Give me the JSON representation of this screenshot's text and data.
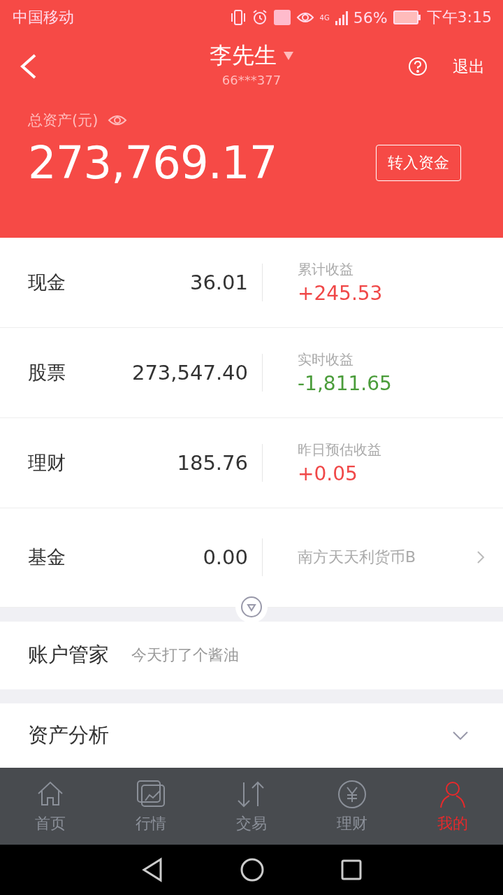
{
  "status_bar": {
    "carrier": "中国移动",
    "network": "4G",
    "battery": "56%",
    "time": "下午3:15"
  },
  "header": {
    "name": "李先生",
    "account": "66***377",
    "logout": "退出"
  },
  "total": {
    "label": "总资产(元)",
    "value": "273,769.17",
    "button": "转入资金"
  },
  "assets": [
    {
      "kind": "gain",
      "label": "现金",
      "value": "36.01",
      "side_label": "累计收益",
      "side_value": "+245.53",
      "color": "#f04848"
    },
    {
      "kind": "gain",
      "label": "股票",
      "value": "273,547.40",
      "side_label": "实时收益",
      "side_value": "-1,811.65",
      "color": "#4a9c3a"
    },
    {
      "kind": "gain",
      "label": "理财",
      "value": "185.76",
      "side_label": "昨日预估收益",
      "side_value": "+0.05",
      "color": "#f04848"
    },
    {
      "kind": "link",
      "label": "基金",
      "value": "0.00",
      "side_label": "南方天天利货币B"
    }
  ],
  "butler": {
    "title": "账户管家",
    "note": "今天打了个酱油"
  },
  "analysis": {
    "title": "资产分析",
    "expanded": false
  },
  "tabs": [
    {
      "label": "首页",
      "selected": false
    },
    {
      "label": "行情",
      "selected": false
    },
    {
      "label": "交易",
      "selected": false
    },
    {
      "label": "理财",
      "selected": false
    },
    {
      "label": "我的",
      "selected": true
    }
  ]
}
